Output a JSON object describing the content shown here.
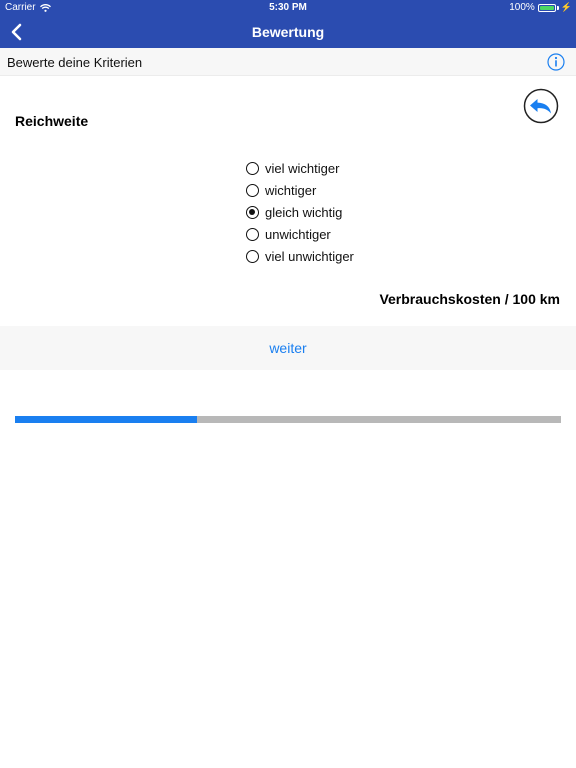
{
  "status_bar": {
    "carrier": "Carrier",
    "time": "5:30 PM",
    "battery": "100%"
  },
  "nav": {
    "title": "Bewertung",
    "back_icon": "chevron-left-icon"
  },
  "subheader": {
    "title": "Bewerte deine Kriterien",
    "info_icon": "info-icon"
  },
  "comparison": {
    "criterion_a": "Reichweite",
    "criterion_b": "Verbrauchskosten / 100 km",
    "options": [
      {
        "label": "viel wichtiger",
        "checked": false
      },
      {
        "label": "wichtiger",
        "checked": false
      },
      {
        "label": "gleich wichtig",
        "checked": true
      },
      {
        "label": "unwichtiger",
        "checked": false
      },
      {
        "label": "viel unwichtiger",
        "checked": false
      }
    ],
    "undo_icon": "undo-arrow-icon"
  },
  "actions": {
    "next_label": "weiter"
  },
  "progress": {
    "value": 0.333
  },
  "colors": {
    "nav_bg": "#2b4cb0",
    "accent": "#1a7ff0",
    "progress_track": "#b8b8b8",
    "battery": "#4cd964"
  }
}
